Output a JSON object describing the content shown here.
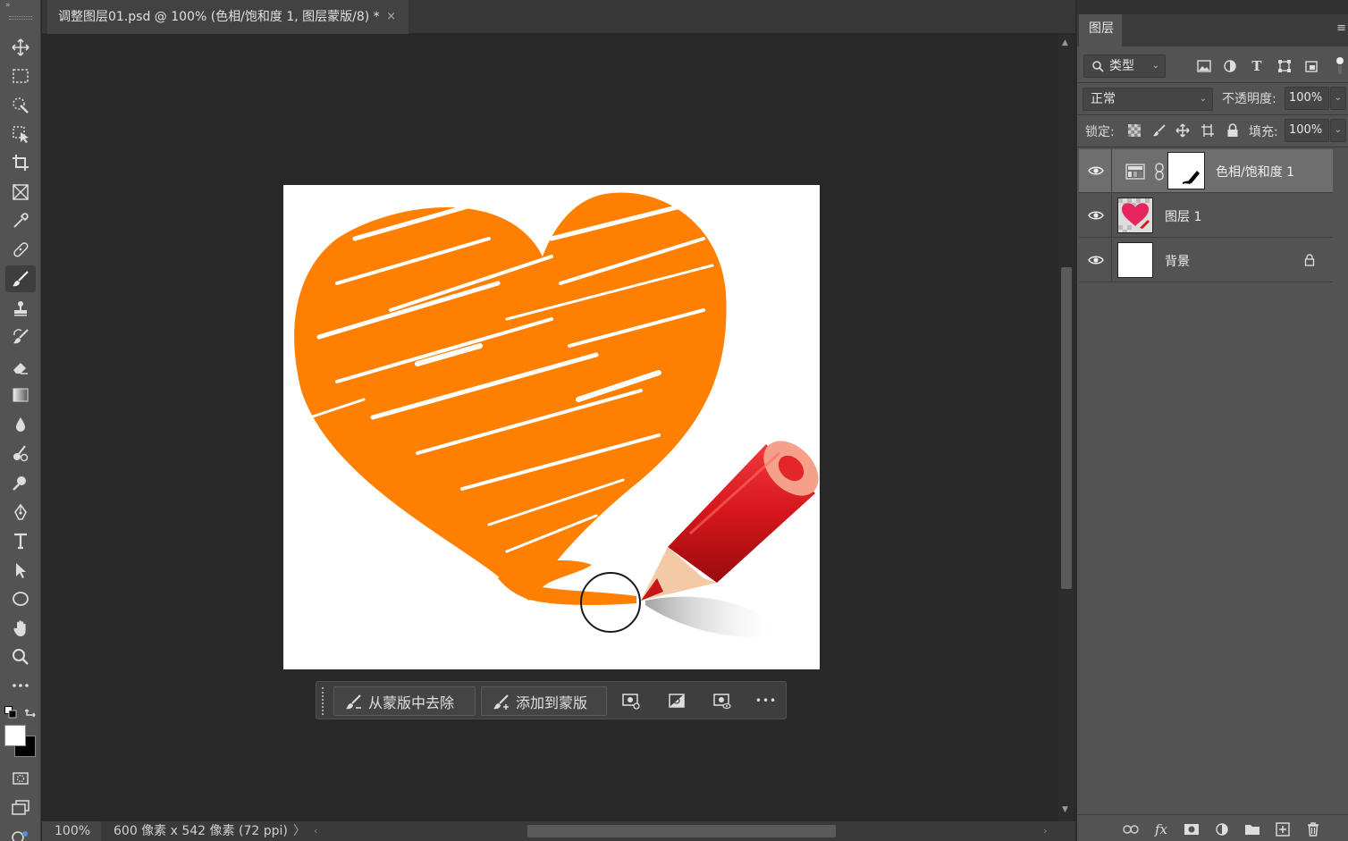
{
  "document": {
    "tab_title": "调整图层01.psd @ 100% (色相/饱和度 1, 图层蒙版/8) *",
    "close_glyph": "×"
  },
  "toolbar": {
    "collapse_glyph": "»",
    "tools": [
      "move-tool",
      "marquee-tool",
      "quick-selection-tool",
      "object-selection-tool",
      "crop-tool",
      "frame-tool",
      "eyedropper-tool",
      "healing-brush-tool",
      "brush-tool",
      "clone-stamp-tool",
      "history-brush-tool",
      "eraser-tool",
      "gradient-tool",
      "blur-tool",
      "dodge-tool",
      "smudge-tool",
      "pen-tool",
      "type-tool",
      "path-selection-tool",
      "ellipse-tool",
      "hand-tool",
      "zoom-tool",
      "more-tools"
    ],
    "active_tool": "brush-tool",
    "foreground_color": "#ffffff",
    "background_color": "#000000"
  },
  "mask_bar": {
    "subtract_label": "从蒙版中去除",
    "add_label": "添加到蒙版",
    "more_glyph": "•••"
  },
  "status": {
    "zoom": "100%",
    "doc_info": "600 像素 x 542 像素 (72 ppi)",
    "chevron": "〉",
    "left_arrow": "‹",
    "right_arrow": "›"
  },
  "layers_panel": {
    "tab_label": "图层",
    "menu_glyph": "≡",
    "filter_kind": "类型",
    "blend_mode": "正常",
    "opacity_label": "不透明度:",
    "opacity_value": "100%",
    "lock_label": "锁定:",
    "fill_label": "填充:",
    "fill_value": "100%",
    "type_glyph": "T",
    "layers": [
      {
        "name": "色相/饱和度 1",
        "selected": true,
        "kind": "adjustment"
      },
      {
        "name": "图层 1",
        "selected": false,
        "kind": "pixel"
      },
      {
        "name": "背景",
        "selected": false,
        "kind": "background",
        "locked": true
      }
    ]
  },
  "colors": {
    "heart_orange": "#ff8000",
    "pencil_red": "#d4161b",
    "ui_bg": "#535353"
  }
}
